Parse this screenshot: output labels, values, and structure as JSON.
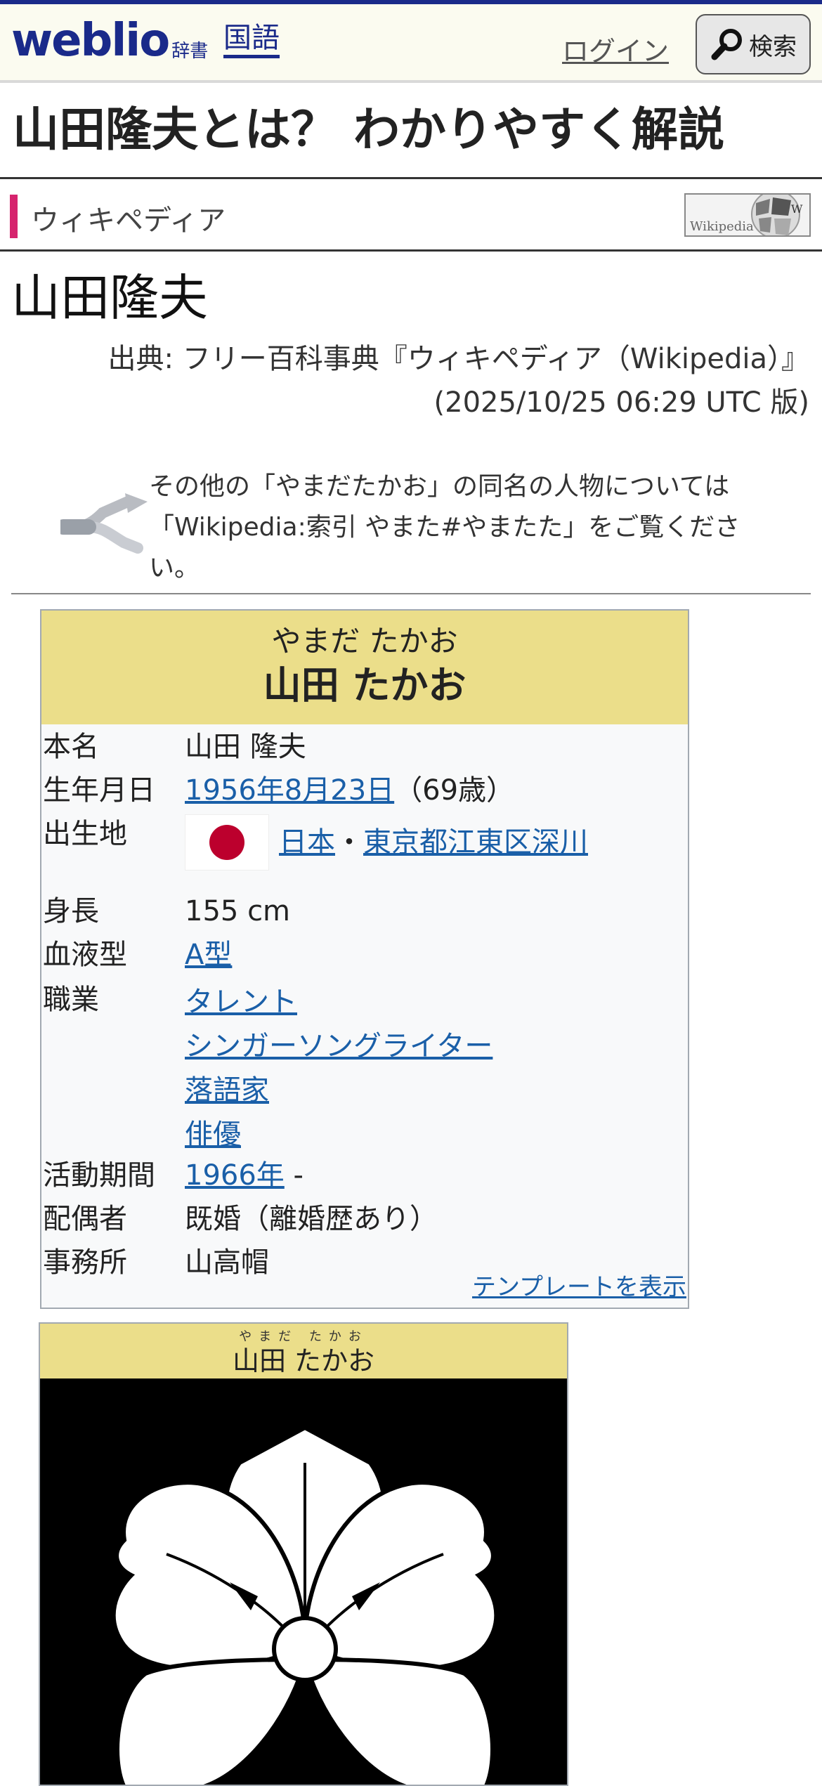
{
  "header": {
    "logo": "weblio",
    "logo_sub": "辞書",
    "nav_kokugo": "国語",
    "login": "ログイン",
    "search_label": "検索"
  },
  "page_title": "山田隆夫とは？ わかりやすく解説",
  "section": {
    "label": "ウィキペディア",
    "logo_text": "Wikipedia"
  },
  "article": {
    "heading": "山田隆夫",
    "source_line1": "出典: フリー百科事典『ウィキペディア（Wikipedia）』",
    "source_line2": "(2025/10/25 06:29 UTC 版)",
    "hatnote": "その他の「やまだたかお」の同名の人物については「Wikipedia:索引 やまた#やまたた」をご覧ください。"
  },
  "infobox": {
    "kana": "やまだ たかお",
    "name": "山田 たかお",
    "rows": [
      {
        "key": "本名",
        "value": "山田 隆夫"
      },
      {
        "key": "生年月日",
        "link": "1956年8月23日",
        "suffix": "（69歳）"
      },
      {
        "key": "出生地",
        "link1": "日本",
        "sep": "・",
        "link2": "東京都江東区深川"
      },
      {
        "key": "身長",
        "value": "155 cm"
      },
      {
        "key": "血液型",
        "link": "A型"
      },
      {
        "key": "職業",
        "links": [
          "タレント",
          "シンガーソングライター",
          "落語家",
          "俳優"
        ]
      },
      {
        "key": "活動期間",
        "link": "1966年",
        "suffix": " -"
      },
      {
        "key": "配偶者",
        "value": "既婚（離婚歴あり）"
      },
      {
        "key": "事務所",
        "value": "山高帽"
      }
    ],
    "template_link": "テンプレートを表示"
  },
  "crestbox": {
    "ruby": "やまだ たかお",
    "name": "山田 たかお"
  }
}
